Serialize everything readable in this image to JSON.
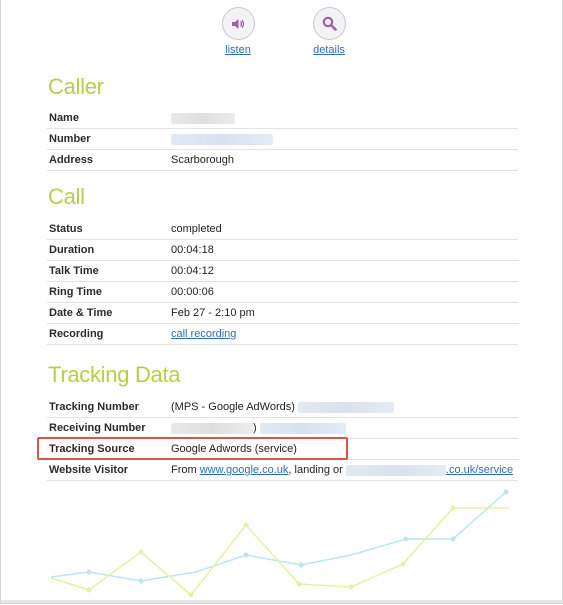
{
  "actions": [
    {
      "label": "listen",
      "icon": "speaker-icon"
    },
    {
      "label": "details",
      "icon": "search-icon"
    }
  ],
  "caller": {
    "title": "Caller",
    "rows": [
      {
        "label": "Name",
        "value": ""
      },
      {
        "label": "Number",
        "value": ""
      },
      {
        "label": "Address",
        "value": "Scarborough"
      }
    ]
  },
  "call": {
    "title": "Call",
    "rows": [
      {
        "label": "Status",
        "value": "completed"
      },
      {
        "label": "Duration",
        "value": "00:04:18"
      },
      {
        "label": "Talk Time",
        "value": "00:04:12"
      },
      {
        "label": "Ring Time",
        "value": "00:00:06"
      },
      {
        "label": "Date & Time",
        "value": "Feb 27 - 2:10 pm"
      },
      {
        "label": "Recording",
        "value": "call recording"
      }
    ]
  },
  "tracking": {
    "title": "Tracking Data",
    "rows": [
      {
        "label": "Tracking Number",
        "value": "(MPS - Google AdWords)"
      },
      {
        "label": "Receiving Number",
        "value": ")"
      },
      {
        "label": "Tracking Source",
        "value": "Google Adwords (service)"
      },
      {
        "label": "Website Visitor",
        "prefix": "From ",
        "link1": "www.google.co.uk",
        "middle": ", landing or",
        "link2": ".co.uk/service"
      }
    ]
  },
  "colors": {
    "accent_green": "#b7cf48",
    "link_blue": "#2f6db8",
    "highlight_red": "#d9534f",
    "chart_yellow": "#e8efa6",
    "chart_blue": "#bfe3f1"
  }
}
